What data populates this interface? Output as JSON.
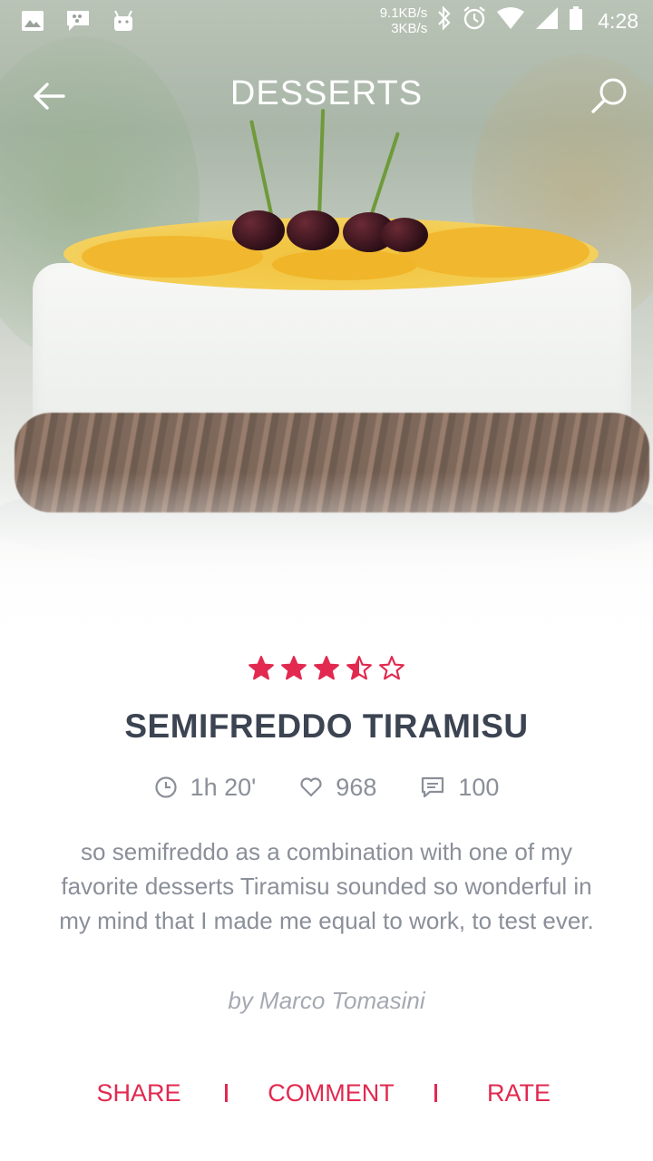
{
  "status_bar": {
    "net_down": "9.1KB/s",
    "net_up": "3KB/s",
    "time": "4:28"
  },
  "toolbar": {
    "title": "DESSERTS",
    "back_icon": "arrow-back-icon",
    "search_icon": "search-icon"
  },
  "recipe": {
    "rating_stars": 3.5,
    "rating_max": 5,
    "title": "SEMIFREDDO TIRAMISU",
    "time": "1h 20'",
    "likes": "968",
    "comments": "100",
    "description": "so semifreddo as a combination with one of my favorite desserts Tiramisu sounded so wonderful in my mind that I made me equal to work, to test ever.",
    "author": "by Marco Tomasini"
  },
  "actions": {
    "share": "SHARE",
    "comment": "COMMENT",
    "rate": "RATE"
  },
  "colors": {
    "accent": "#e2294f",
    "title_text": "#3c4452",
    "body_text": "#8a8f99"
  }
}
